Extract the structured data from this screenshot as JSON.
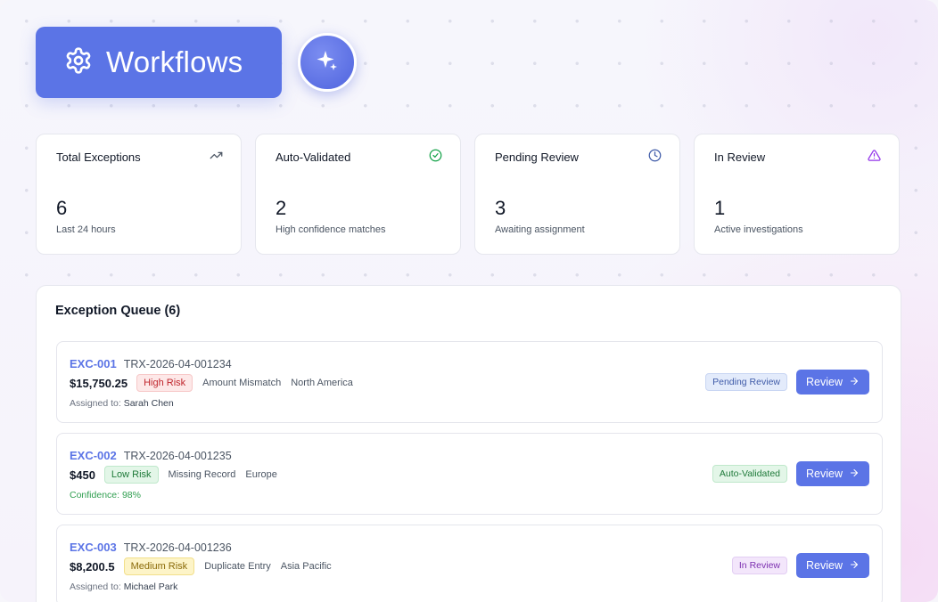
{
  "header": {
    "title": "Workflows",
    "settings_icon": "gear-icon",
    "ai_icon": "sparkles-icon"
  },
  "stats": [
    {
      "label": "Total Exceptions",
      "value": "6",
      "sub": "Last 24 hours",
      "icon": "trending-up-icon",
      "color": "#4b5563"
    },
    {
      "label": "Auto-Validated",
      "value": "2",
      "sub": "High confidence matches",
      "icon": "check-circle-icon",
      "color": "#16a34a"
    },
    {
      "label": "Pending Review",
      "value": "3",
      "sub": "Awaiting assignment",
      "icon": "clock-icon",
      "color": "#3f5ba8"
    },
    {
      "label": "In Review",
      "value": "1",
      "sub": "Active investigations",
      "icon": "alert-triangle-icon",
      "color": "#9333ea"
    }
  ],
  "queue": {
    "title": "Exception Queue (6)",
    "review_label": "Review",
    "rows": [
      {
        "id": "EXC-001",
        "trx": "TRX-2026-04-001234",
        "amount": "$15,750.25",
        "risk": "High Risk",
        "type": "Amount Mismatch",
        "region": "North America",
        "detail_prefix": "Assigned to:",
        "detail_value": "Sarah Chen",
        "status": "Pending Review"
      },
      {
        "id": "EXC-002",
        "trx": "TRX-2026-04-001235",
        "amount": "$450",
        "risk": "Low Risk",
        "type": "Missing Record",
        "region": "Europe",
        "detail": "Confidence: 98%",
        "status": "Auto-Validated"
      },
      {
        "id": "EXC-003",
        "trx": "TRX-2026-04-001236",
        "amount": "$8,200.5",
        "risk": "Medium Risk",
        "type": "Duplicate Entry",
        "region": "Asia Pacific",
        "detail_prefix": "Assigned to:",
        "detail_value": "Michael Park",
        "status": "In Review"
      }
    ]
  },
  "colors": {
    "accent": "#5b74e6",
    "high_risk": "#c0262d",
    "low_risk": "#1f7a3a",
    "medium_risk": "#8a6a08"
  }
}
